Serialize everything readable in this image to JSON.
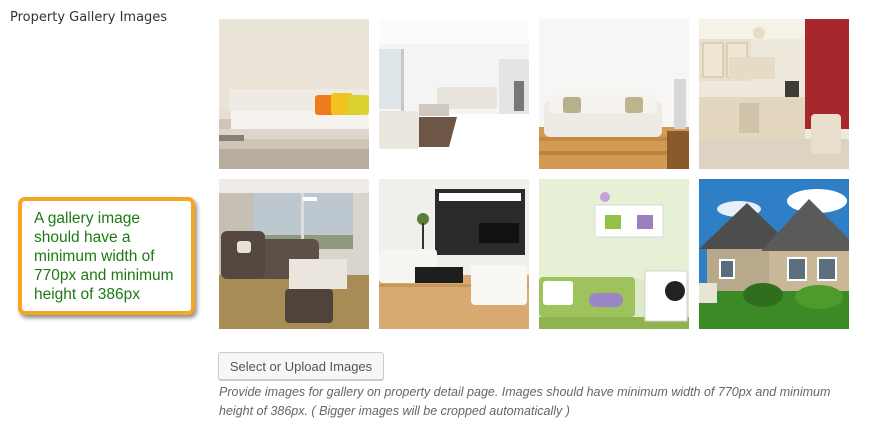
{
  "field": {
    "label": "Property Gallery Images"
  },
  "gallery": {
    "images": [
      {
        "alt": "living-room-orange-pillows-icon"
      },
      {
        "alt": "white-living-room-icon"
      },
      {
        "alt": "sofa-wood-floor-icon"
      },
      {
        "alt": "kitchen-red-wall-icon"
      },
      {
        "alt": "living-room-window-view-icon"
      },
      {
        "alt": "modern-tv-lounge-icon"
      },
      {
        "alt": "green-kids-room-icon"
      },
      {
        "alt": "house-exterior-icon"
      }
    ]
  },
  "callout": {
    "lines": [
      "A gallery image",
      "should have a",
      "minimum width of",
      "770px and minimum",
      "height of 386px"
    ],
    "border_color": "#f5a623",
    "text_color": "#1d7a12"
  },
  "upload": {
    "button_label": "Select or Upload Images"
  },
  "help": {
    "line1": "Provide images for gallery on property detail page. Images should have minimum width of 770px and minimum",
    "line2": "height of 386px. ( Bigger images will be cropped automatically )"
  }
}
